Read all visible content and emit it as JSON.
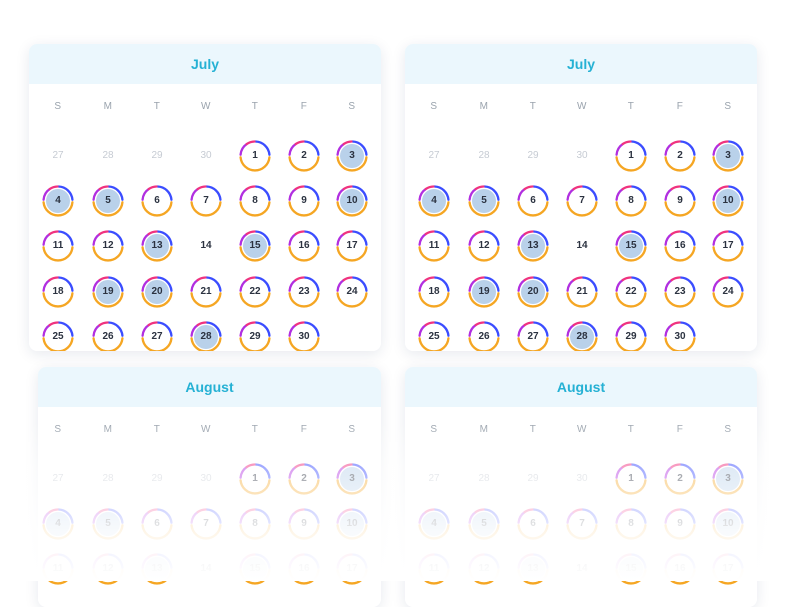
{
  "weekday_labels": [
    "S",
    "M",
    "T",
    "W",
    "T",
    "F",
    "S"
  ],
  "ring_colors": {
    "blue": "#3b4dff",
    "purple": "#b12fe0",
    "pink": "#f0337f",
    "orange": "#f5a623"
  },
  "highlight_color": "#b9d1ea",
  "calendars": [
    {
      "month": "July",
      "leading_days": [
        "27",
        "28",
        "29",
        "30"
      ],
      "days": [
        "1",
        "2",
        "3",
        "4",
        "5",
        "6",
        "7",
        "8",
        "9",
        "10",
        "11",
        "12",
        "13",
        "14",
        "15",
        "16",
        "17",
        "18",
        "19",
        "20",
        "21",
        "22",
        "23",
        "24",
        "25",
        "26",
        "27",
        "28",
        "29",
        "30"
      ],
      "highlighted": [
        "3",
        "4",
        "5",
        "10",
        "13",
        "15",
        "19",
        "20",
        "28"
      ],
      "no_ring": [
        "14"
      ]
    },
    {
      "month": "July",
      "leading_days": [
        "27",
        "28",
        "29",
        "30"
      ],
      "days": [
        "1",
        "2",
        "3",
        "4",
        "5",
        "6",
        "7",
        "8",
        "9",
        "10",
        "11",
        "12",
        "13",
        "14",
        "15",
        "16",
        "17",
        "18",
        "19",
        "20",
        "21",
        "22",
        "23",
        "24",
        "25",
        "26",
        "27",
        "28",
        "29",
        "30"
      ],
      "highlighted": [
        "3",
        "4",
        "5",
        "10",
        "13",
        "15",
        "19",
        "20",
        "28"
      ],
      "no_ring": [
        "14"
      ]
    },
    {
      "month": "August",
      "leading_days": [
        "27",
        "28",
        "29",
        "30"
      ],
      "days": [
        "1",
        "2",
        "3",
        "4",
        "5",
        "6",
        "7",
        "8",
        "9",
        "10",
        "11",
        "12",
        "13",
        "14",
        "15",
        "16",
        "17"
      ],
      "highlighted": [
        "3",
        "4",
        "5",
        "10",
        "13",
        "15"
      ],
      "no_ring": [
        "14"
      ]
    },
    {
      "month": "August",
      "leading_days": [
        "27",
        "28",
        "29",
        "30"
      ],
      "days": [
        "1",
        "2",
        "3",
        "4",
        "5",
        "6",
        "7",
        "8",
        "9",
        "10",
        "11",
        "12",
        "13",
        "14",
        "15",
        "16",
        "17"
      ],
      "highlighted": [
        "3",
        "4",
        "5",
        "10",
        "13",
        "15"
      ],
      "no_ring": [
        "14"
      ]
    }
  ]
}
